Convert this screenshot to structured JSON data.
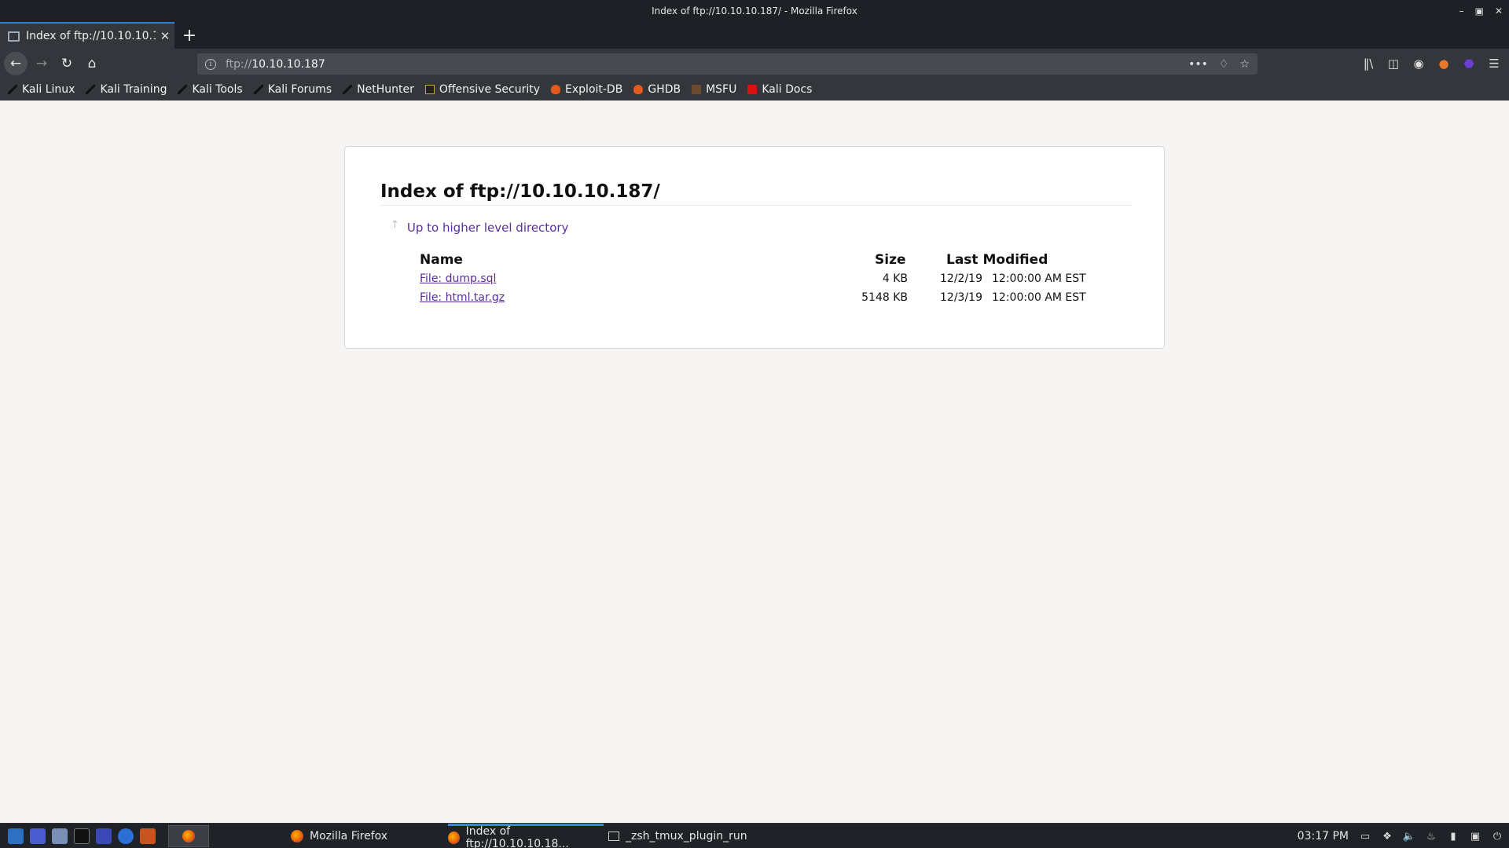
{
  "window": {
    "title": "Index of ftp://10.10.10.187/ - Mozilla Firefox"
  },
  "tab": {
    "label": "Index of ftp://10.10.10.18"
  },
  "urlbar": {
    "protocol": "ftp://",
    "host": "10.10.10.187"
  },
  "bookmarks": [
    {
      "label": "Kali Linux",
      "icon": "kali-dragon-icon"
    },
    {
      "label": "Kali Training",
      "icon": "kali-dragon-icon"
    },
    {
      "label": "Kali Tools",
      "icon": "kali-dragon-icon"
    },
    {
      "label": "Kali Forums",
      "icon": "kali-dragon-icon"
    },
    {
      "label": "NetHunter",
      "icon": "kali-dragon-icon"
    },
    {
      "label": "Offensive Security",
      "icon": "offsec-icon"
    },
    {
      "label": "Exploit-DB",
      "icon": "exploitdb-icon"
    },
    {
      "label": "GHDB",
      "icon": "ghdb-icon"
    },
    {
      "label": "MSFU",
      "icon": "msfu-icon"
    },
    {
      "label": "Kali Docs",
      "icon": "kali-docs-icon"
    }
  ],
  "page": {
    "title": "Index of ftp://10.10.10.187/",
    "up_link": "Up to higher level directory",
    "columns": {
      "name": "Name",
      "size": "Size",
      "modified": "Last Modified"
    },
    "files": [
      {
        "name": "File: dump.sql",
        "size": "4 KB",
        "date": "12/2/19",
        "time": "12:00:00 AM EST"
      },
      {
        "name": "File: html.tar.gz",
        "size": "5148 KB",
        "date": "12/3/19",
        "time": "12:00:00 AM EST"
      }
    ]
  },
  "taskbar": {
    "tasks": [
      {
        "label": "Mozilla Firefox"
      },
      {
        "label": "Index of ftp://10.10.10.18..."
      },
      {
        "label": "_zsh_tmux_plugin_run"
      }
    ],
    "clock": "03:17 PM"
  },
  "colors": {
    "link": "#5a2da0",
    "chrome_dark": "#1d2025",
    "chrome": "#33363b",
    "accent": "#2e7fd7"
  }
}
